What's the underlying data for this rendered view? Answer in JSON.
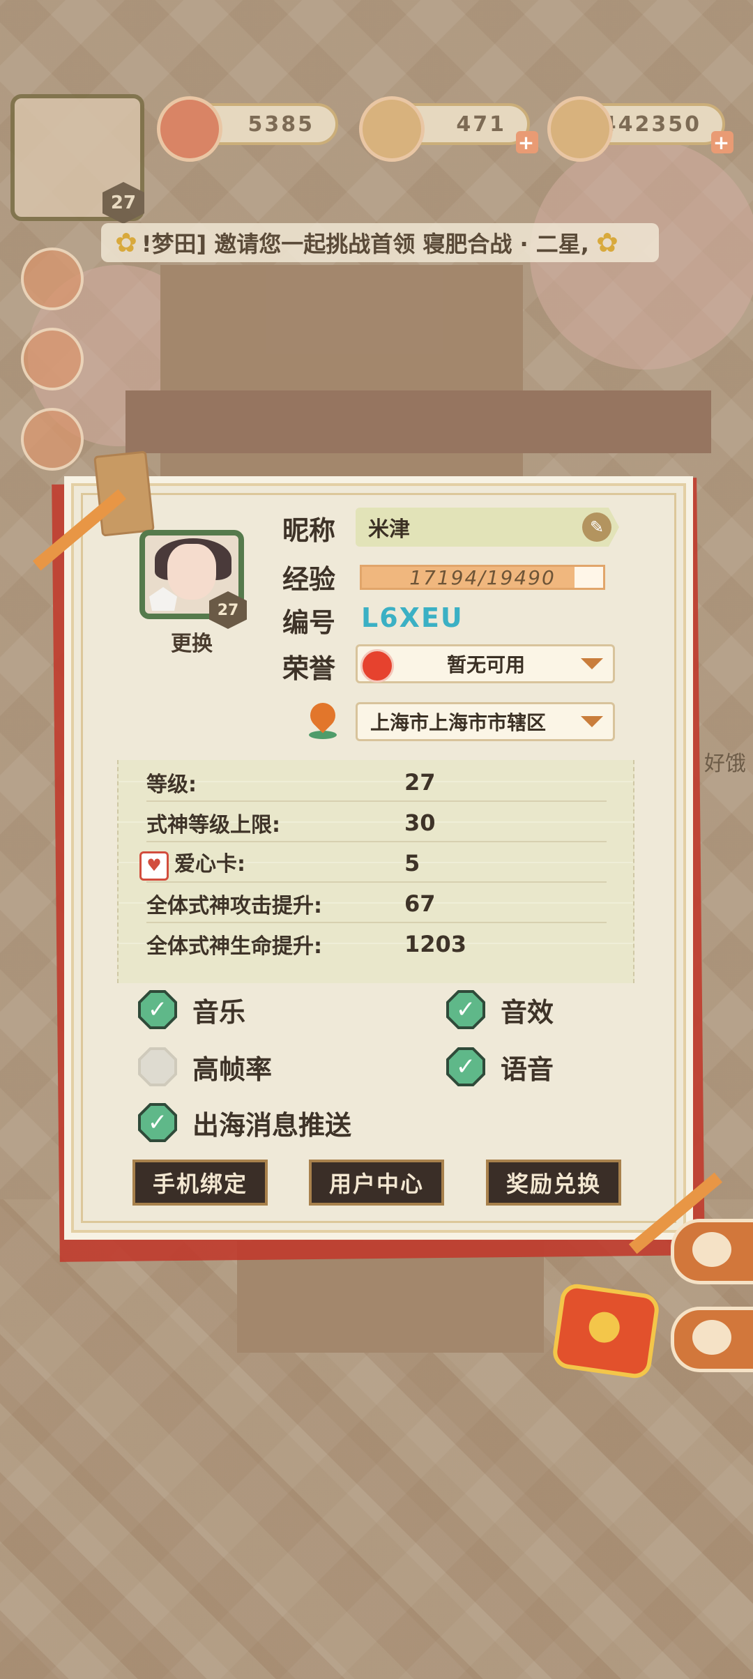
{
  "topbar": {
    "player_level": "27",
    "resources": [
      {
        "name": "plum-coin",
        "value": "5385"
      },
      {
        "name": "magatama",
        "value": "471"
      },
      {
        "name": "gold-coin",
        "value": "442350"
      }
    ],
    "plus": "+"
  },
  "ticker": {
    "text": "!梦田] 邀请您一起挑战首领 寝肥合战 · 二星,"
  },
  "profile": {
    "avatar_level": "27",
    "change_label": "更换",
    "nickname_label": "昵称",
    "nickname_value": "米津",
    "exp_label": "经验",
    "exp_text": "17194/19490",
    "exp_fraction": 0.882,
    "id_label": "编号",
    "id_value": "L6XEU",
    "honor_label": "荣誉",
    "honor_value": "暂无可用",
    "location_value": "上海市上海市市辖区"
  },
  "stats": [
    {
      "label": "等级:",
      "value": "27"
    },
    {
      "label": "式神等级上限:",
      "value": "30"
    },
    {
      "label": "爱心卡:",
      "value": "5"
    },
    {
      "label": "全体式神攻击提升:",
      "value": "67"
    },
    {
      "label": "全体式神生命提升:",
      "value": "1203"
    }
  ],
  "settings": {
    "music": {
      "label": "音乐",
      "checked": true
    },
    "sfx": {
      "label": "音效",
      "checked": true
    },
    "high_fps": {
      "label": "高帧率",
      "checked": false
    },
    "voice": {
      "label": "语音",
      "checked": true
    },
    "push": {
      "label": "出海消息推送",
      "checked": true
    },
    "check_mark": "✓"
  },
  "actions": {
    "bind_phone": "手机绑定",
    "user_center": "用户中心",
    "redeem": "奖励兑换"
  },
  "side_label": "好饿"
}
